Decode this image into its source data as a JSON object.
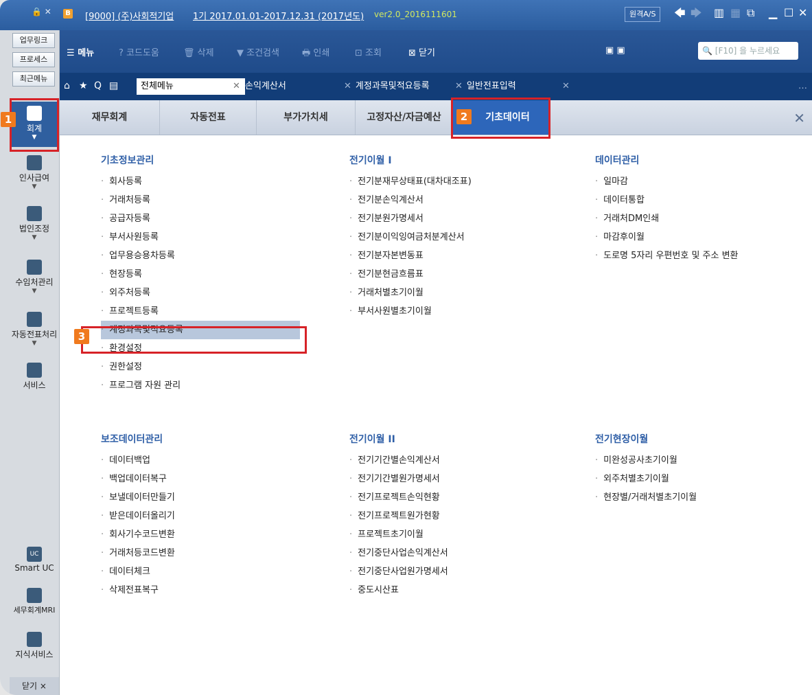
{
  "titlebar": {
    "company": "[9000] (주)사회적기업",
    "period": "1기 2017.01.01-2017.12.31 (2017년도)",
    "version": "ver2.0_2016111601",
    "remote_as": "원격A/S"
  },
  "leftbar": {
    "small_buttons": [
      "업무링크",
      "프로세스",
      "최근메뉴"
    ],
    "nav": [
      "회계",
      "인사급여",
      "법인조정",
      "수임처관리",
      "자동전표처리",
      "서비스"
    ],
    "bottom": [
      "Smart UC",
      "세무회계MRI",
      "지식서비스"
    ],
    "close_label": "닫기 ×",
    "uc_badge": "UC"
  },
  "toolbar": {
    "menu": "메뉴",
    "code": "코드도움",
    "delete": "삭제",
    "filter": "조건검색",
    "print": "인쇄",
    "view": "조회",
    "close": "닫기",
    "search_placeholder": "[F10] 을 누르세요"
  },
  "tabs": {
    "all_menu": "전체메뉴",
    "items": [
      "손익계산서",
      "계정과목및적요등록",
      "일반전표입력"
    ]
  },
  "categories": [
    "재무회계",
    "자동전표",
    "부가가치세",
    "고정자산/자금예산",
    "기초데이터"
  ],
  "active_category": "기초데이터",
  "sections": {
    "basic_info": {
      "title": "기초정보관리",
      "items": [
        "회사등록",
        "거래처등록",
        "공급자등록",
        "부서사원등록",
        "업무용승용차등록",
        "현장등록",
        "외주처등록",
        "프로젝트등록",
        "계정과목및적요등록",
        "환경설정",
        "권한설정",
        "프로그램 자원 관리"
      ]
    },
    "carryover1": {
      "title": "전기이월 I",
      "items": [
        "전기분재무상태표(대차대조표)",
        "전기분손익계산서",
        "전기분원가명세서",
        "전기분이익잉여금처분계산서",
        "전기분자본변동표",
        "전기분현금흐름표",
        "거래처별초기이월",
        "부서사원별초기이월"
      ]
    },
    "data_mgmt": {
      "title": "데이터관리",
      "items": [
        "일마감",
        "데이터통합",
        "거래처DM인쇄",
        "마감후이월",
        "도로명 5자리 우편번호 및 주소 변환"
      ]
    },
    "aux_data": {
      "title": "보조데이터관리",
      "items": [
        "데이터백업",
        "백업데이터복구",
        "보낼데이터만들기",
        "받은데이터올리기",
        "회사기수코드변환",
        "거래처등코드변환",
        "데이터체크",
        "삭제전표복구"
      ]
    },
    "carryover2": {
      "title": "전기이월 II",
      "items": [
        "전기기간별손익계산서",
        "전기기간별원가명세서",
        "전기프로젝트손익현황",
        "전기프로젝트원가현황",
        "프로젝트초기이월",
        "전기중단사업손익계산서",
        "전기중단사업원가명세서",
        "중도시산표"
      ]
    },
    "site_carryover": {
      "title": "전기현장이월",
      "items": [
        "미완성공사초기이월",
        "외주처별초기이월",
        "현장별/거래처별초기이월"
      ]
    }
  },
  "annotations": [
    "1",
    "2",
    "3"
  ],
  "colors": {
    "highlight": "#d72227",
    "badge": "#f07a1e",
    "accent": "#2d66ba"
  }
}
